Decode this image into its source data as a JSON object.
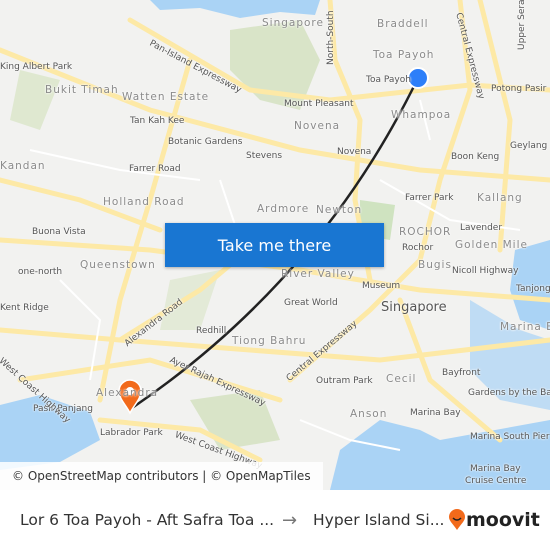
{
  "map": {
    "labels": [
      "Singapore",
      "Braddell",
      "Toa Payoh",
      "Toa Payoh",
      "Pan-Island Expressway",
      "North-South",
      "Central Expressway",
      "Upper Serangoon",
      "King Albert Park",
      "Bukit Timah",
      "Watten Estate",
      "Mount Pleasant",
      "Potong Pasir",
      "Tan Kah Kee",
      "Novena",
      "Whampoa",
      "Botanic Gardens",
      "Stevens",
      "Novena",
      "Boon Keng",
      "Geylang Bahru",
      "Kandan",
      "Farrer Road",
      "Holland Road",
      "Farrer Park",
      "Kallang",
      "Ardmore",
      "Newton",
      "Buona Vista",
      "ROCHOR",
      "Lavender",
      "Rochor",
      "Golden Mile",
      "Queenstown",
      "one-north",
      "Bugis",
      "Nicoll Highway",
      "River Valley",
      "Museum",
      "Tanjong",
      "Kent Ridge",
      "Great World",
      "Singapore",
      "Alexandra Road",
      "Marina East",
      "Redhill",
      "Tiong Bahru",
      "Ayer Rajah Expressway",
      "Central Expressway",
      "Outram Park",
      "Cecil",
      "Bayfront",
      "Gardens by the Bay",
      "Alexandra",
      "Pasir Panjang",
      "Anson",
      "Marina Bay",
      "Labrador Park",
      "West Coast Highway",
      "Marina South Pier",
      "Marina Bay",
      "Cruise Centre",
      "West Coast Highway"
    ],
    "colors": {
      "route": "#222222",
      "origin": "#2d7ff9",
      "destination": "#f26a1b",
      "water": "#aad3f5",
      "park": "#d9e4c8",
      "road": "#fde9a6",
      "button": "#1976d2"
    },
    "origin_icon": "origin-dot-icon",
    "destination_icon": "map-pin-icon"
  },
  "cta": {
    "label": "Take me there"
  },
  "attribution": "© OpenStreetMap contributors | © OpenMapTiles",
  "footer": {
    "from": "Lor 6 Toa Payoh - Aft Safra Toa ...",
    "arrow": "→",
    "to": "Hyper Island Si...",
    "brand": "moovit"
  }
}
